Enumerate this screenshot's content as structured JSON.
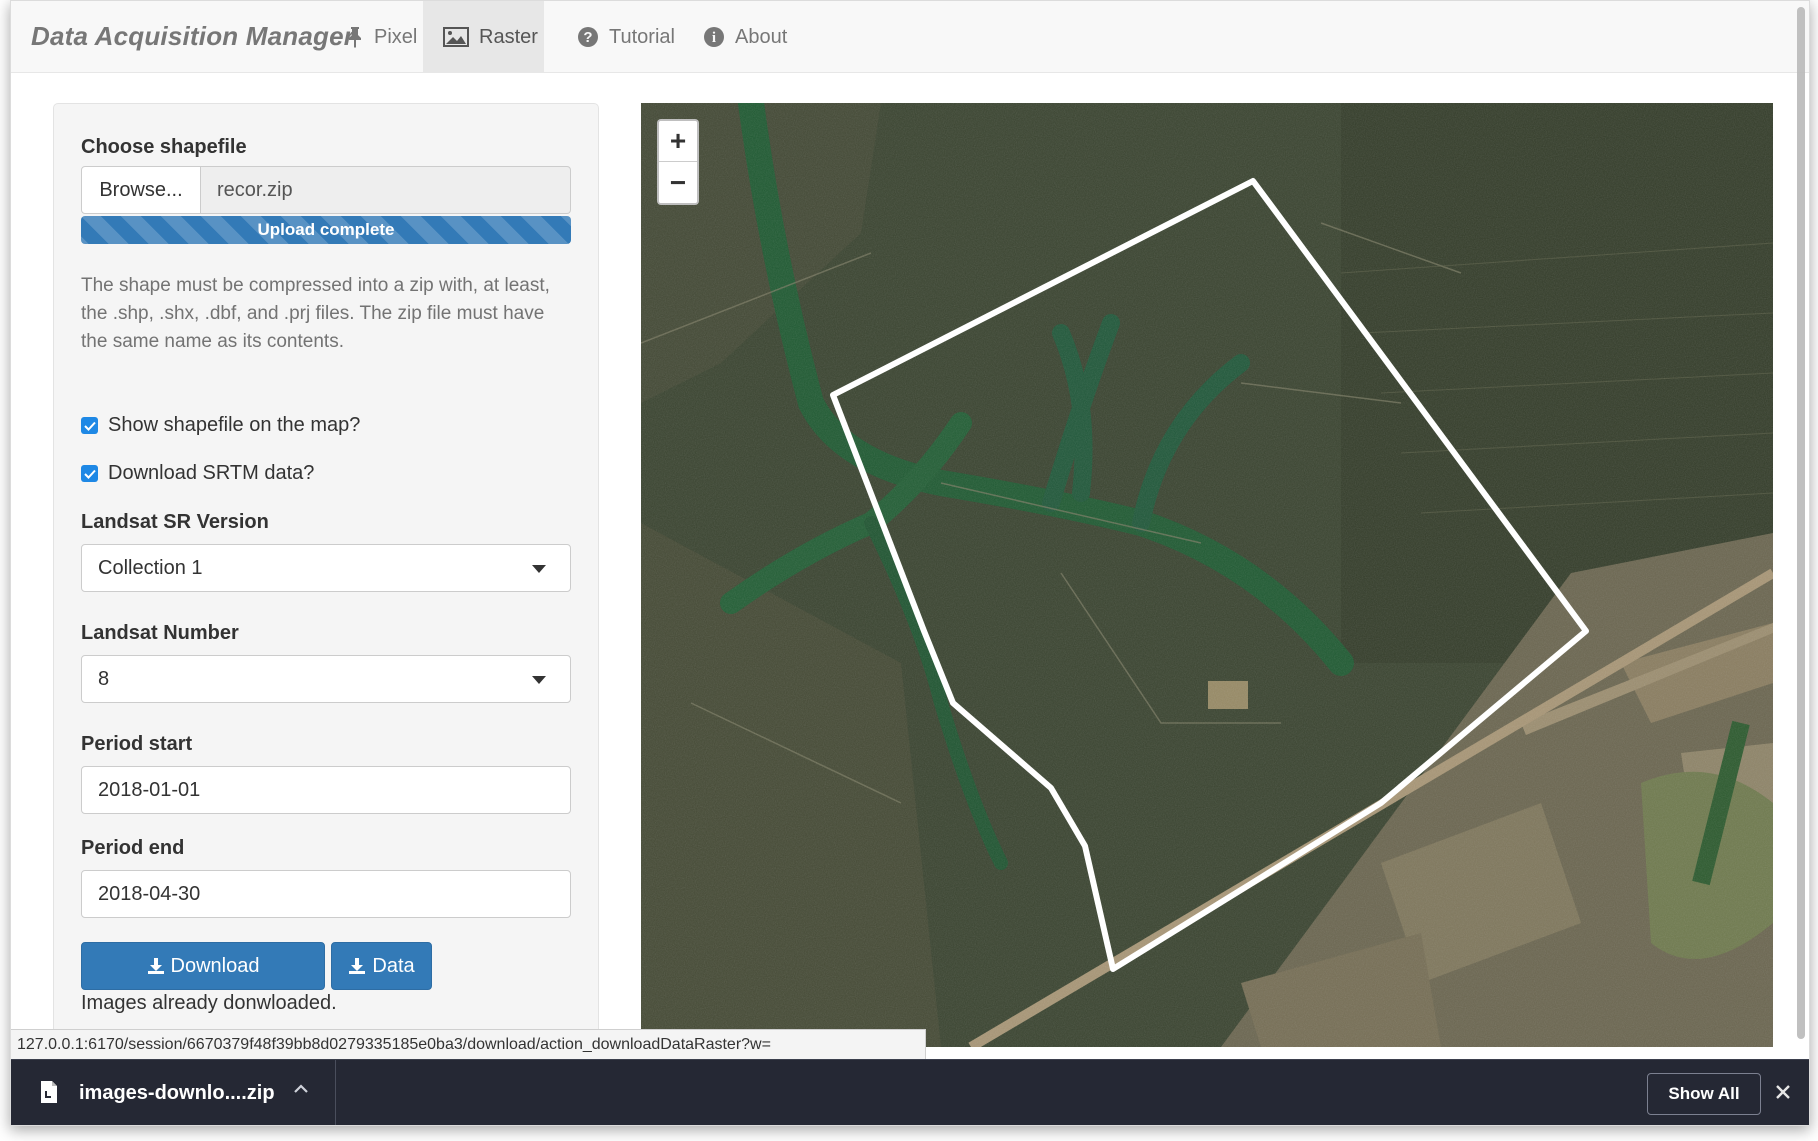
{
  "app": {
    "brand": "Data Acquisition Manager"
  },
  "nav": {
    "items": [
      {
        "label": "Pixel",
        "icon": "pin-icon"
      },
      {
        "label": "Raster",
        "icon": "picture-icon",
        "active": true
      },
      {
        "label": "Tutorial",
        "icon": "question-icon"
      },
      {
        "label": "About",
        "icon": "info-icon"
      }
    ]
  },
  "sidebar": {
    "shapefile_label": "Choose shapefile",
    "browse_label": "Browse...",
    "file_name": "recor.zip",
    "upload_status": "Upload complete",
    "upload_progress_percent": 100,
    "help_text": "The shape must be compressed into a zip with, at least, the .shp, .shx, .dbf, and .prj files. The zip file must have the same name as its contents.",
    "show_shapefile_label": "Show shapefile on the map?",
    "show_shapefile_checked": true,
    "download_srtm_label": "Download SRTM data?",
    "download_srtm_checked": true,
    "landsat_sr_label": "Landsat SR Version",
    "landsat_sr_value": "Collection 1",
    "landsat_number_label": "Landsat Number",
    "landsat_number_value": "8",
    "period_start_label": "Period start",
    "period_start_value": "2018-01-01",
    "period_end_label": "Period end",
    "period_end_value": "2018-04-30",
    "download_button": "Download",
    "data_button": "Data",
    "status_message": "Images already donwloaded."
  },
  "map": {
    "zoom_in": "+",
    "zoom_out": "−",
    "boundary_color": "#ffffff"
  },
  "status_bar": {
    "url": "127.0.0.1:6170/session/6670379f48f39bb8d0279335185e0ba3/download/action_downloadDataRaster?w="
  },
  "downloads": {
    "file_name": "images-downlo....zip",
    "show_all": "Show All"
  },
  "colors": {
    "primary": "#337ab7",
    "download_bar": "#252834",
    "checkbox": "#1e88e5"
  }
}
